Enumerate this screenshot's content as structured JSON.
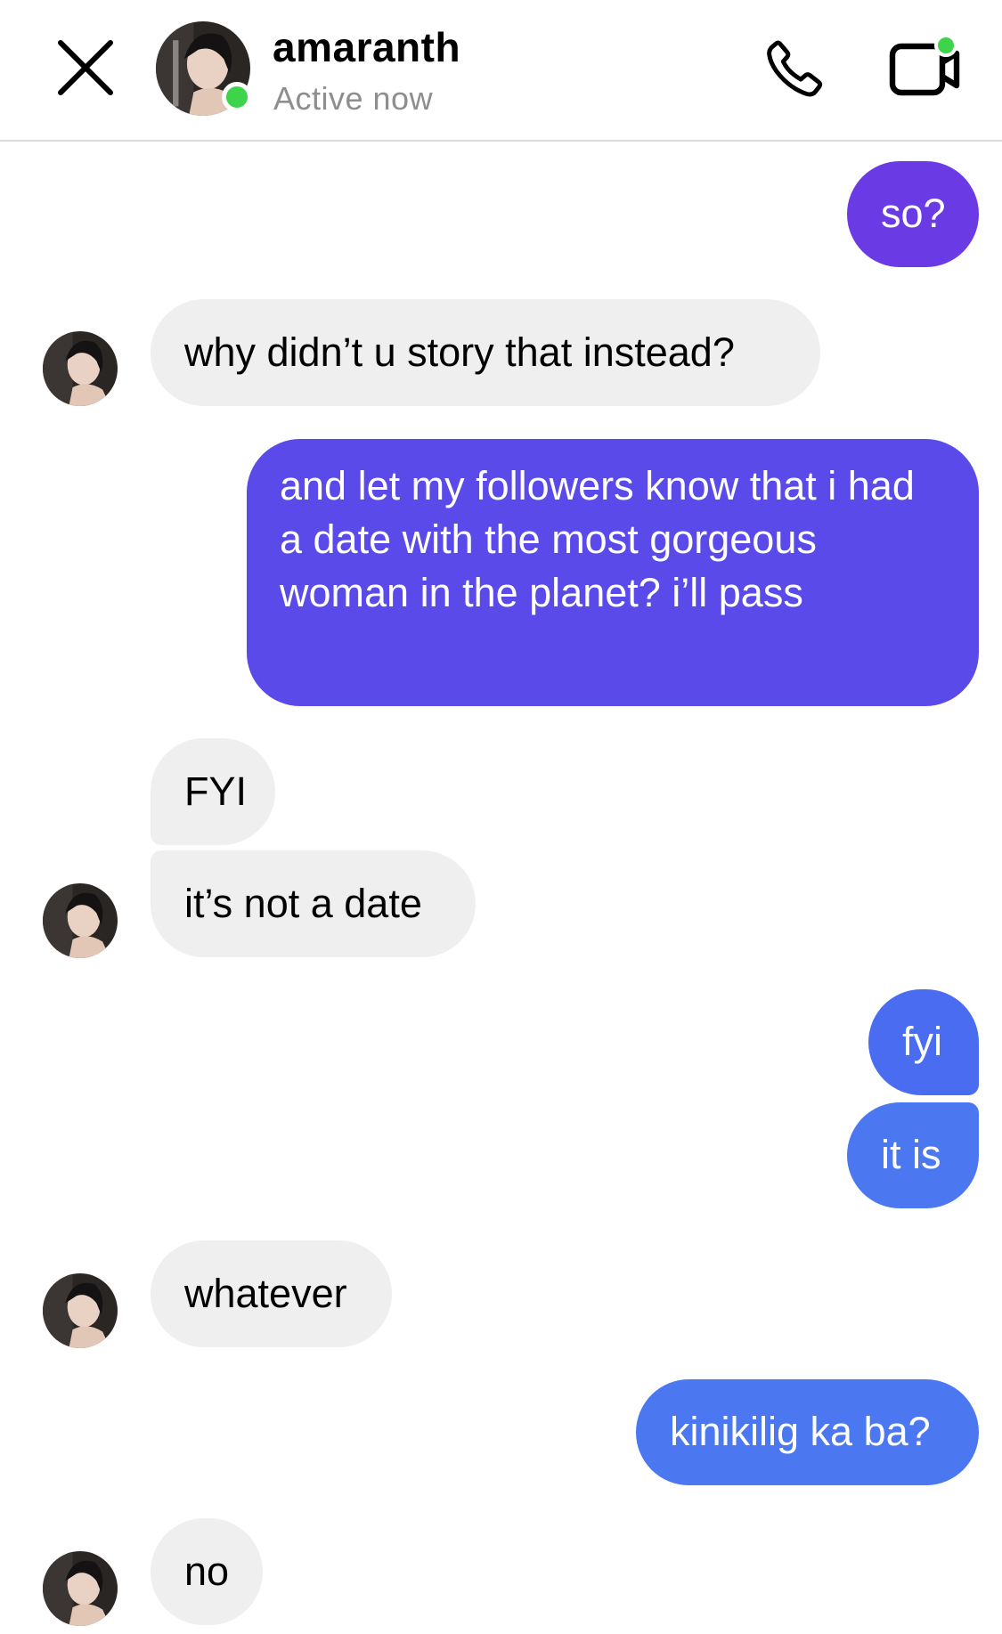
{
  "header": {
    "contact_name": "amaranth",
    "status": "Active now",
    "icons": {
      "close": "close-icon",
      "call": "phone-icon",
      "video": "video-camera-icon"
    }
  },
  "colors": {
    "incoming_bubble": "#efefef",
    "online": "#3dd34a",
    "outgoing_purple": "#6a3ae4",
    "outgoing_indigo": "#5a4ae9",
    "outgoing_blue": "#4a6cf0",
    "outgoing_light_blue": "#4b78f0"
  },
  "messages": [
    {
      "from": "me",
      "text": "so?"
    },
    {
      "from": "them",
      "text": "why didn’t u story that instead?"
    },
    {
      "from": "me",
      "text": "and let my followers know that i had a date with the most gorgeous woman in the planet? i’ll pass"
    },
    {
      "from": "them",
      "text": "FYI"
    },
    {
      "from": "them",
      "text": "it’s not a date"
    },
    {
      "from": "me",
      "text": "fyi"
    },
    {
      "from": "me",
      "text": "it is"
    },
    {
      "from": "them",
      "text": "whatever"
    },
    {
      "from": "me",
      "text": "kinikilig ka ba?"
    },
    {
      "from": "them",
      "text": "no"
    }
  ]
}
